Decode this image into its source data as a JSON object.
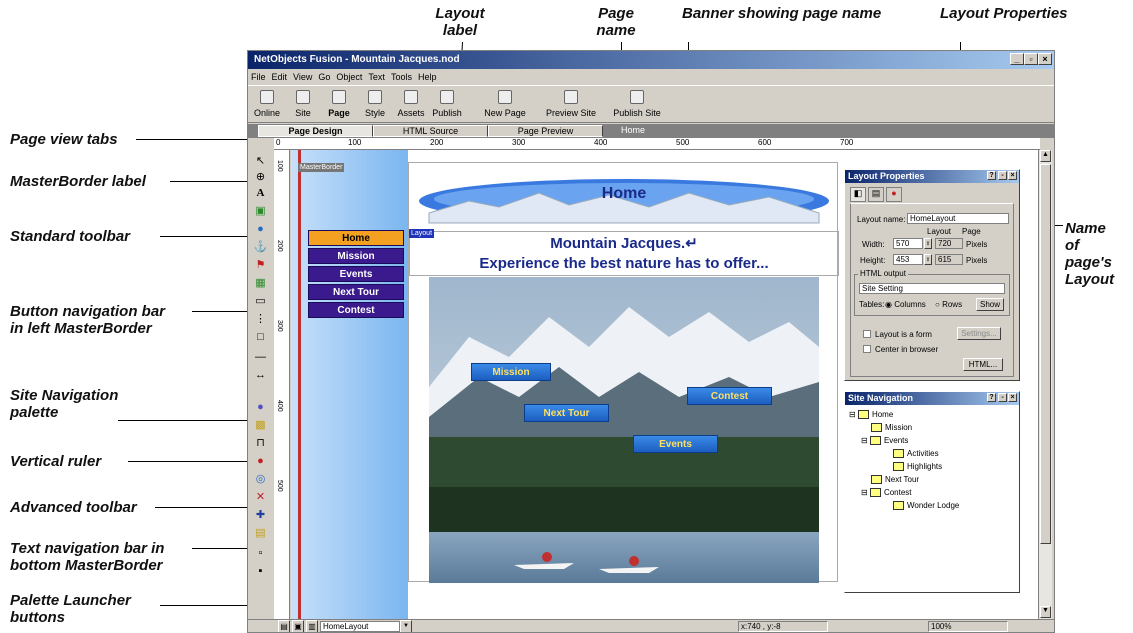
{
  "callouts": {
    "layout_label": "Layout\nlabel",
    "page_name": "Page\nname",
    "banner": "Banner showing page name",
    "layout_properties": "Layout Properties",
    "page_view_tabs": "Page view tabs",
    "masterborder_label": "MasterBorder label",
    "standard_toolbar": "Standard toolbar",
    "button_nav_bar": "Button navigation bar\nin left MasterBorder",
    "site_nav_palette": "Site Navigation\npalette",
    "vertical_ruler": "Vertical ruler",
    "advanced_toolbar": "Advanced toolbar",
    "text_nav_bar": "Text navigation bar in\nbottom MasterBorder",
    "palette_launcher": "Palette Launcher\nbuttons",
    "name_of_layout": "Name\nof\npage's\nLayout"
  },
  "window": {
    "title": "NetObjects Fusion - Mountain Jacques.nod",
    "menu": [
      "File",
      "Edit",
      "View",
      "Go",
      "Object",
      "Text",
      "Tools",
      "Help"
    ],
    "toolbar": [
      "Online",
      "Site",
      "Page",
      "Style",
      "Assets",
      "Publish",
      "New Page",
      "Preview Site",
      "Publish Site"
    ],
    "tabs": [
      "Page Design",
      "HTML Source",
      "Page Preview",
      "Home"
    ]
  },
  "ruler": {
    "h_ticks": [
      "0",
      "100",
      "200",
      "300",
      "400",
      "500",
      "600",
      "700"
    ],
    "v_ticks": [
      "100",
      "200",
      "300",
      "400",
      "500"
    ]
  },
  "canvas": {
    "masterborder_label": "MasterBorder",
    "nav_buttons": [
      "Home",
      "Mission",
      "Events",
      "Next Tour",
      "Contest"
    ],
    "banner_text": "Home",
    "layout_tag": "Layout",
    "headline_1": "Mountain Jacques.↵",
    "headline_2": "Experience the best nature has to offer...",
    "photo_nav": [
      "Mission",
      "Next Tour",
      "Contest",
      "Events"
    ]
  },
  "layout_props": {
    "title": "Layout Properties",
    "name_label": "Layout name:",
    "name_value": "HomeLayout",
    "col_layout": "Layout",
    "col_page": "Page",
    "width_label": "Width:",
    "width_layout": "570",
    "width_page": "720",
    "height_label": "Height:",
    "height_layout": "453",
    "height_page": "615",
    "unit": "Pixels",
    "html_output": "HTML output",
    "site_setting": "Site Setting",
    "tables_label": "Tables:",
    "columns": "Columns",
    "rows": "Rows",
    "show": "Show",
    "layout_is_form": "Layout is a form",
    "settings": "Settings...",
    "center_browser": "Center in browser",
    "html_btn": "HTML..."
  },
  "site_nav": {
    "title": "Site Navigation",
    "tree": [
      "Home",
      "Mission",
      "Events",
      "Activities",
      "Highlights",
      "Next Tour",
      "Contest",
      "Wonder Lodge"
    ]
  },
  "statusbar": {
    "layout_dropdown": "HomeLayout",
    "coords": "x:740 , y:-8",
    "zoom": "100%"
  }
}
